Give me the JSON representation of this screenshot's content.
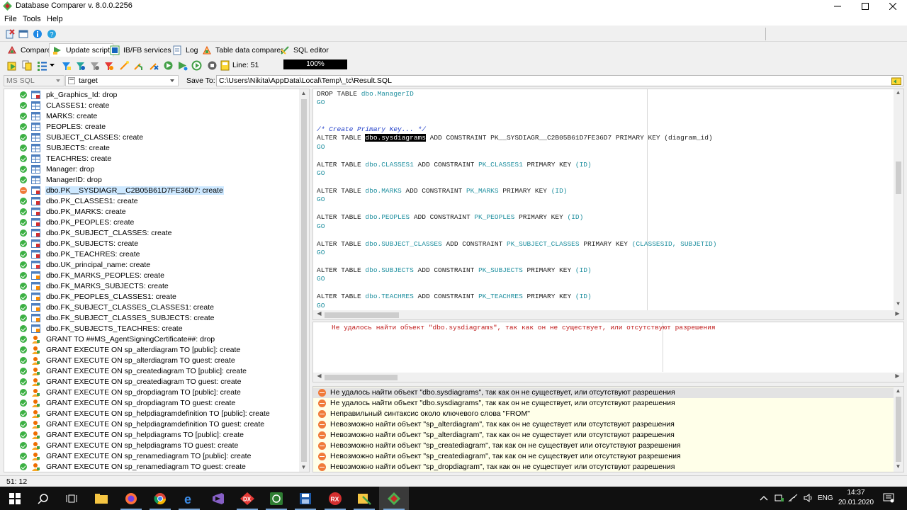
{
  "window": {
    "title": "Database Comparer v. 8.0.0.2256"
  },
  "menu": [
    "File",
    "Tools",
    "Help"
  ],
  "tabs": [
    {
      "label": "Compare",
      "icon": "compare-icon"
    },
    {
      "label": "Update script",
      "icon": "update-script-icon",
      "active": true
    },
    {
      "label": "IB/FB services",
      "icon": "services-icon"
    },
    {
      "label": "Log",
      "icon": "log-icon"
    },
    {
      "label": "Table data comparer",
      "icon": "table-data-icon"
    },
    {
      "label": "SQL editor",
      "icon": "sql-editor-icon"
    }
  ],
  "toolbar2": {
    "line_label": "Line: 51",
    "progress": "100%",
    "progress_value": 100
  },
  "db_selector": {
    "type": "MS SQL",
    "target": "target",
    "save_to_label": "Save To:",
    "save_to_path": "C:\\Users\\Nikita\\AppData\\Local\\Temp\\_tc\\Result.SQL"
  },
  "tree": {
    "items": [
      {
        "text": "pk_Graphics_Id: drop",
        "status": "ok",
        "icon": "pk"
      },
      {
        "text": "CLASSES1: create",
        "status": "ok",
        "icon": "table"
      },
      {
        "text": "MARKS: create",
        "status": "ok",
        "icon": "table"
      },
      {
        "text": "PEOPLES: create",
        "status": "ok",
        "icon": "table"
      },
      {
        "text": "SUBJECT_CLASSES: create",
        "status": "ok",
        "icon": "table"
      },
      {
        "text": "SUBJECTS: create",
        "status": "ok",
        "icon": "table"
      },
      {
        "text": "TEACHRES: create",
        "status": "ok",
        "icon": "table"
      },
      {
        "text": "Manager: drop",
        "status": "ok",
        "icon": "table"
      },
      {
        "text": "ManagerID: drop",
        "status": "ok",
        "icon": "table"
      },
      {
        "text": "dbo.PK__SYSDIAGR__C2B05B61D7FE36D7: create",
        "status": "error",
        "icon": "pk",
        "selected": true
      },
      {
        "text": "dbo.PK_CLASSES1: create",
        "status": "ok",
        "icon": "pk"
      },
      {
        "text": "dbo.PK_MARKS: create",
        "status": "ok",
        "icon": "pk"
      },
      {
        "text": "dbo.PK_PEOPLES: create",
        "status": "ok",
        "icon": "pk"
      },
      {
        "text": "dbo.PK_SUBJECT_CLASSES: create",
        "status": "ok",
        "icon": "pk"
      },
      {
        "text": "dbo.PK_SUBJECTS: create",
        "status": "ok",
        "icon": "pk"
      },
      {
        "text": "dbo.PK_TEACHRES: create",
        "status": "ok",
        "icon": "pk"
      },
      {
        "text": "dbo.UK_principal_name: create",
        "status": "ok",
        "icon": "uk"
      },
      {
        "text": "dbo.FK_MARKS_PEOPLES: create",
        "status": "ok",
        "icon": "fk"
      },
      {
        "text": "dbo.FK_MARKS_SUBJECTS: create",
        "status": "ok",
        "icon": "fk"
      },
      {
        "text": "dbo.FK_PEOPLES_CLASSES1: create",
        "status": "ok",
        "icon": "fk"
      },
      {
        "text": "dbo.FK_SUBJECT_CLASSES_CLASSES1: create",
        "status": "ok",
        "icon": "fk"
      },
      {
        "text": "dbo.FK_SUBJECT_CLASSES_SUBJECTS: create",
        "status": "ok",
        "icon": "fk"
      },
      {
        "text": "dbo.FK_SUBJECTS_TEACHRES: create",
        "status": "ok",
        "icon": "fk"
      },
      {
        "text": "GRANT  TO ##MS_AgentSigningCertificate##: drop",
        "status": "ok",
        "icon": "grant"
      },
      {
        "text": "GRANT EXECUTE ON sp_alterdiagram TO [public]: create",
        "status": "ok",
        "icon": "grant"
      },
      {
        "text": "GRANT EXECUTE ON sp_alterdiagram TO guest: create",
        "status": "ok",
        "icon": "grant"
      },
      {
        "text": "GRANT EXECUTE ON sp_creatediagram TO [public]: create",
        "status": "ok",
        "icon": "grant"
      },
      {
        "text": "GRANT EXECUTE ON sp_creatediagram TO guest: create",
        "status": "ok",
        "icon": "grant"
      },
      {
        "text": "GRANT EXECUTE ON sp_dropdiagram TO [public]: create",
        "status": "ok",
        "icon": "grant"
      },
      {
        "text": "GRANT EXECUTE ON sp_dropdiagram TO guest: create",
        "status": "ok",
        "icon": "grant"
      },
      {
        "text": "GRANT EXECUTE ON sp_helpdiagramdefinition TO [public]: create",
        "status": "ok",
        "icon": "grant"
      },
      {
        "text": "GRANT EXECUTE ON sp_helpdiagramdefinition TO guest: create",
        "status": "ok",
        "icon": "grant"
      },
      {
        "text": "GRANT EXECUTE ON sp_helpdiagrams TO [public]: create",
        "status": "ok",
        "icon": "grant"
      },
      {
        "text": "GRANT EXECUTE ON sp_helpdiagrams TO guest: create",
        "status": "ok",
        "icon": "grant"
      },
      {
        "text": "GRANT EXECUTE ON sp_renamediagram TO [public]: create",
        "status": "ok",
        "icon": "grant"
      },
      {
        "text": "GRANT EXECUTE ON sp_renamediagram TO guest: create",
        "status": "ok",
        "icon": "grant"
      }
    ]
  },
  "script": [
    {
      "t": "stmt",
      "parts": [
        [
          "kw",
          "DROP TABLE "
        ],
        [
          "id",
          "dbo.ManagerID"
        ]
      ]
    },
    {
      "t": "go",
      "parts": [
        [
          "go",
          "GO"
        ]
      ]
    },
    {
      "t": "blank",
      "parts": []
    },
    {
      "t": "blank",
      "parts": []
    },
    {
      "t": "comment",
      "parts": [
        [
          "cm",
          "/* Create Primary Key... */"
        ]
      ]
    },
    {
      "t": "stmt",
      "parts": [
        [
          "kw",
          "ALTER TABLE "
        ],
        [
          "hl",
          "dbo.sysdiagrams"
        ],
        [
          "kw",
          " ADD CONSTRAINT PK__SYSDIAGR__C2B05B61D7FE36D7 PRIMARY KEY (diagram_id)"
        ]
      ]
    },
    {
      "t": "go",
      "parts": [
        [
          "go",
          "GO"
        ]
      ]
    },
    {
      "t": "blank",
      "parts": []
    },
    {
      "t": "stmt",
      "parts": [
        [
          "kw",
          "ALTER TABLE "
        ],
        [
          "id",
          "dbo.CLASSES1"
        ],
        [
          "kw",
          " ADD CONSTRAINT "
        ],
        [
          "id",
          "PK_CLASSES1"
        ],
        [
          "kw",
          " PRIMARY KEY "
        ],
        [
          "id",
          "(ID)"
        ]
      ]
    },
    {
      "t": "go",
      "parts": [
        [
          "go",
          "GO"
        ]
      ]
    },
    {
      "t": "blank",
      "parts": []
    },
    {
      "t": "stmt",
      "parts": [
        [
          "kw",
          "ALTER TABLE "
        ],
        [
          "id",
          "dbo.MARKS"
        ],
        [
          "kw",
          " ADD CONSTRAINT "
        ],
        [
          "id",
          "PK_MARKS"
        ],
        [
          "kw",
          " PRIMARY KEY "
        ],
        [
          "id",
          "(ID)"
        ]
      ]
    },
    {
      "t": "go",
      "parts": [
        [
          "go",
          "GO"
        ]
      ]
    },
    {
      "t": "blank",
      "parts": []
    },
    {
      "t": "stmt",
      "parts": [
        [
          "kw",
          "ALTER TABLE "
        ],
        [
          "id",
          "dbo.PEOPLES"
        ],
        [
          "kw",
          " ADD CONSTRAINT "
        ],
        [
          "id",
          "PK_PEOPLES"
        ],
        [
          "kw",
          " PRIMARY KEY "
        ],
        [
          "id",
          "(ID)"
        ]
      ]
    },
    {
      "t": "go",
      "parts": [
        [
          "go",
          "GO"
        ]
      ]
    },
    {
      "t": "blank",
      "parts": []
    },
    {
      "t": "stmt",
      "parts": [
        [
          "kw",
          "ALTER TABLE "
        ],
        [
          "id",
          "dbo.SUBJECT_CLASSES"
        ],
        [
          "kw",
          " ADD CONSTRAINT "
        ],
        [
          "id",
          "PK_SUBJECT_CLASSES"
        ],
        [
          "kw",
          " PRIMARY KEY "
        ],
        [
          "id",
          "(CLASSESID, SUBJETID)"
        ]
      ]
    },
    {
      "t": "go",
      "parts": [
        [
          "go",
          "GO"
        ]
      ]
    },
    {
      "t": "blank",
      "parts": []
    },
    {
      "t": "stmt",
      "parts": [
        [
          "kw",
          "ALTER TABLE "
        ],
        [
          "id",
          "dbo.SUBJECTS"
        ],
        [
          "kw",
          " ADD CONSTRAINT "
        ],
        [
          "id",
          "PK_SUBJECTS"
        ],
        [
          "kw",
          " PRIMARY KEY "
        ],
        [
          "id",
          "(ID)"
        ]
      ]
    },
    {
      "t": "go",
      "parts": [
        [
          "go",
          "GO"
        ]
      ]
    },
    {
      "t": "blank",
      "parts": []
    },
    {
      "t": "stmt",
      "parts": [
        [
          "kw",
          "ALTER TABLE "
        ],
        [
          "id",
          "dbo.TEACHRES"
        ],
        [
          "kw",
          " ADD CONSTRAINT "
        ],
        [
          "id",
          "PK_TEACHRES"
        ],
        [
          "kw",
          " PRIMARY KEY "
        ],
        [
          "id",
          "(ID)"
        ]
      ]
    },
    {
      "t": "go",
      "parts": [
        [
          "go",
          "GO"
        ]
      ]
    }
  ],
  "message_pane": {
    "text": "Не удалось найти объект \"dbo.sysdiagrams\", так как он не существует, или отсутствуют разрешения"
  },
  "errors": [
    "Не удалось найти объект \"dbo.sysdiagrams\", так как он не существует, или отсутствуют разрешения",
    "Не удалось найти объект \"dbo.sysdiagrams\", так как он не существует, или отсутствуют разрешения",
    "Неправильный синтаксис около ключевого слова \"FROM\"",
    "Невозможно найти объект \"sp_alterdiagram\", так как он не существует или отсутствуют разрешения",
    "Невозможно найти объект \"sp_alterdiagram\", так как он не существует или отсутствуют разрешения",
    "Невозможно найти объект \"sp_creatediagram\", так как он не существует или отсутствуют разрешения",
    "Невозможно найти объект \"sp_creatediagram\", так как он не существует или отсутствуют разрешения",
    "Невозможно найти объект \"sp_dropdiagram\", так как он не существует или отсутствуют разрешения"
  ],
  "status": {
    "position": "51:  12"
  },
  "taskbar": {
    "apps": [
      "start-icon",
      "search-icon",
      "task-view-icon",
      "file-explorer-icon",
      "firefox-icon",
      "chrome-icon",
      "edge-icon",
      "visual-studio-icon",
      "dx-icon",
      "whatsapp-icon",
      "save-app-icon",
      "rx-icon",
      "notes-app-icon",
      "database-comparer-icon"
    ],
    "lang": "ENG",
    "time": "14:37",
    "date": "20.01.2020"
  },
  "colors": {
    "accent_selected": "#cde8ff",
    "ok": "#3cb043",
    "error": "#f07a3a",
    "error_bg": "#ffffe9",
    "highlight": "#000000",
    "identifier": "#1f8f9f",
    "comment": "#1e3cc8",
    "message": "#c01c1c"
  }
}
